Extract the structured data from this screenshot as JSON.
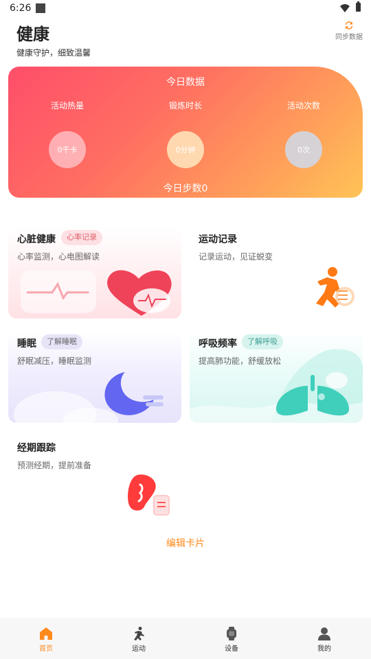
{
  "status": {
    "time": "6:26"
  },
  "header": {
    "title": "健康",
    "subtitle": "健康守护，细致温馨",
    "sync_label": "同步数据"
  },
  "today": {
    "title": "今日数据",
    "metrics": [
      {
        "label": "活动热量",
        "value": "0千卡"
      },
      {
        "label": "锻炼时长",
        "value": "0分钟"
      },
      {
        "label": "活动次数",
        "value": "0次"
      }
    ],
    "steps": "今日步数0"
  },
  "cards": {
    "heart": {
      "title": "心脏健康",
      "tag": "心率记录",
      "desc": "心率监测，心电图解读"
    },
    "sport": {
      "title": "运动记录",
      "desc": "记录运动，见证蜕变"
    },
    "sleep": {
      "title": "睡眠",
      "tag": "了解睡眠",
      "desc": "舒眠减压，睡眠监测"
    },
    "breath": {
      "title": "呼吸频率",
      "tag": "了解呼吸",
      "desc": "提高肺功能，舒缓放松"
    },
    "period": {
      "title": "经期跟踪",
      "desc": "预测经期，提前准备"
    }
  },
  "edit_cards_label": "编辑卡片",
  "nav": [
    {
      "label": "首页",
      "icon": "home-icon"
    },
    {
      "label": "运动",
      "icon": "running-icon"
    },
    {
      "label": "设备",
      "icon": "watch-icon"
    },
    {
      "label": "我的",
      "icon": "person-icon"
    }
  ],
  "colors": {
    "accent": "#ff8a1c",
    "today_gradient_start": "#ff4e6a",
    "today_gradient_end": "#ffc456"
  }
}
